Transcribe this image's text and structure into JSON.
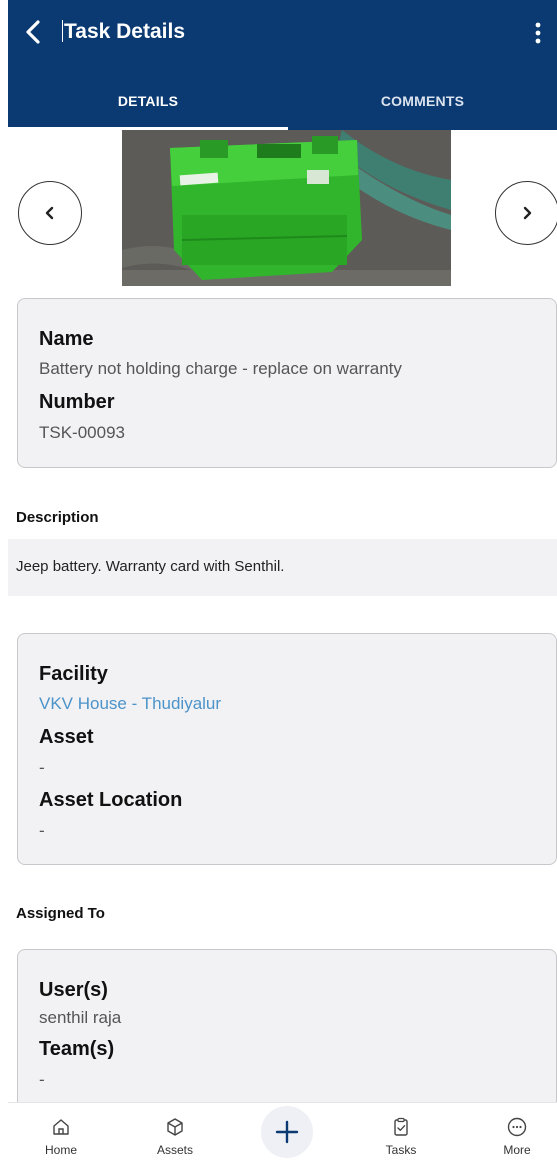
{
  "header": {
    "title": "Task Details",
    "back_icon": "chevron-left-icon",
    "more_icon": "vertical-dots-icon"
  },
  "tabs": [
    {
      "label": "DETAILS",
      "active": true
    },
    {
      "label": "COMMENTS",
      "active": false
    }
  ],
  "carousel": {
    "prev_icon": "chevron-left-icon",
    "next_icon": "chevron-right-icon",
    "image": "battery-photo"
  },
  "summary": {
    "name_label": "Name",
    "name_value": "Battery not holding charge - replace on warranty",
    "number_label": "Number",
    "number_value": "TSK-00093"
  },
  "description": {
    "title": "Description",
    "text": "Jeep battery. Warranty card with Senthil."
  },
  "location": {
    "facility_label": "Facility",
    "facility_value": "VKV House - Thudiyalur",
    "asset_label": "Asset",
    "asset_value": "-",
    "asset_location_label": "Asset Location",
    "asset_location_value": "-"
  },
  "assigned": {
    "title": "Assigned To",
    "users_label": "User(s)",
    "users_value": "senthil raja",
    "teams_label": "Team(s)",
    "teams_value": "-"
  },
  "bottom_nav": [
    {
      "label": "Home",
      "icon": "home-icon"
    },
    {
      "label": "Assets",
      "icon": "cube-icon"
    },
    {
      "label": "",
      "icon": "plus-icon"
    },
    {
      "label": "Tasks",
      "icon": "clipboard-check-icon"
    },
    {
      "label": "More",
      "icon": "more-circle-icon"
    }
  ],
  "colors": {
    "primary": "#0b3a72",
    "link": "#4b93c9",
    "card_bg": "#f2f2f4"
  }
}
